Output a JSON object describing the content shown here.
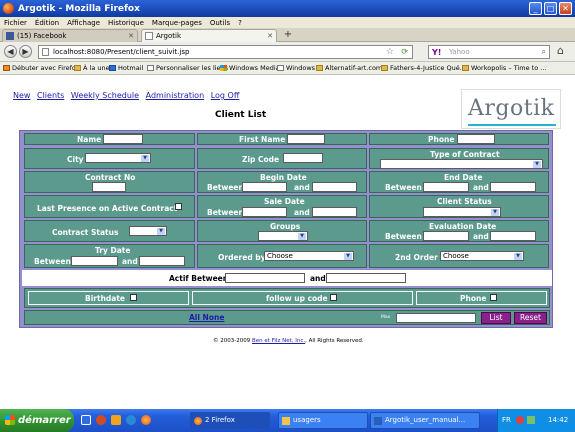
{
  "window": {
    "title": "Argotik - Mozilla Firefox",
    "controls": {
      "minimize": "_",
      "maximize": "□",
      "close": "✕"
    }
  },
  "menu": [
    "Fichier",
    "Édition",
    "Affichage",
    "Historique",
    "Marque-pages",
    "Outils",
    "?"
  ],
  "tabs": [
    {
      "label": "(15) Facebook",
      "active": false
    },
    {
      "label": "Argotik",
      "active": true
    }
  ],
  "new_tab": "+",
  "nav": {
    "url": "localhost:8080/Present/client_suivit.jsp",
    "search_placeholder": "Yahoo",
    "back": "◀",
    "forward": "▶",
    "star": "☆",
    "home": "⌂"
  },
  "bookmarks": [
    "Débuter avec Firefox",
    "À la une",
    "Hotmail",
    "Personnaliser les liens",
    "Windows Media",
    "Windows",
    "Alternatif-art.com",
    "Fathers-4-Justice Qué...",
    "Workopolis – Time to ..."
  ],
  "page": {
    "nav_links": [
      "New",
      "Clients",
      "Weekly Schedule",
      "Administration",
      "Log Off"
    ],
    "title": "Client List",
    "logo": "Argotik",
    "form": {
      "name": "Name",
      "first_name": "First Name",
      "phone": "Phone",
      "city": "City",
      "zip": "Zip Code",
      "type_contract": "Type of Contract",
      "contract_no": "Contract No",
      "begin_date": "Begin Date",
      "end_date": "End Date",
      "between": "Between",
      "and": "and",
      "last_presence": "Last Presence on Active Contract",
      "sale_date": "Sale Date",
      "client_status": "Client Status",
      "contract_status": "Contract Status",
      "groups": "Groups",
      "evaluation_date": "Evaluation Date",
      "try_date": "Try Date",
      "ordered_by": "Ordered by",
      "ordered_by_value": "Choose",
      "second_order": "2nd Order",
      "second_order_value": "Choose",
      "actif_between": "Actif Between",
      "birthdate": "Birthdate",
      "follow_up": "follow up code",
      "phone2": "Phone",
      "all_none": "All None",
      "max": "Max",
      "list_button": "List",
      "reset_button": "Reset"
    },
    "copyright_pre": "© 2003-2009",
    "copyright_link": "Ben et Filz Net, Inc.",
    "copyright_post": "All Rights Reserved."
  },
  "taskbar": {
    "start": "démarrer",
    "buttons": [
      "2 Firefox",
      "usagers",
      "Argotik_user_manual..."
    ],
    "lang": "FR",
    "time": "14:42"
  }
}
